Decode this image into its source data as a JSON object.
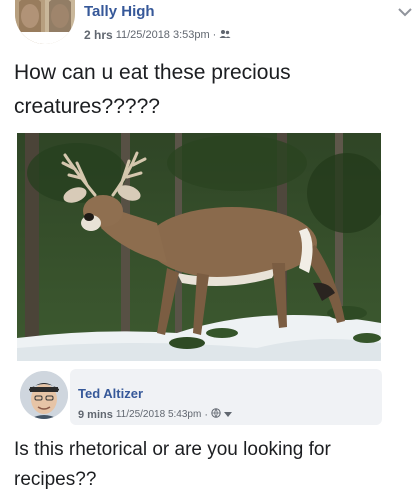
{
  "post": {
    "author": "Tally High",
    "relative_time": "2 hrs",
    "timestamp": "11/25/2018 3:53pm",
    "separator": "·",
    "audience_icon": "friends-icon",
    "text": "How can u eat these precious creatures?????",
    "menu_icon": "chevron-down-icon",
    "photo_icon": "deer-photo"
  },
  "comment": {
    "author": "Ted Altizer",
    "relative_time": "9 mins",
    "timestamp": "11/25/2018 5:43pm",
    "separator": "·",
    "audience_icon": "globe-icon",
    "dropdown_icon": "caret-down-icon",
    "text": "Is this rhetorical or are you looking for recipes??"
  },
  "colors": {
    "name": "#365899",
    "meta": "#616770",
    "bubble": "#f0f2f5"
  }
}
